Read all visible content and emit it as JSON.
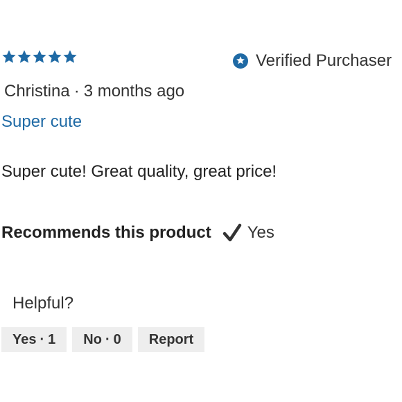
{
  "review": {
    "rating": 5,
    "rating_max": 5,
    "star_color": "#1f6aa5",
    "verified_label": "Verified Purchaser",
    "author": "Christina",
    "separator": "·",
    "time_ago": "3 months ago",
    "title": "Super cute",
    "body": "Super cute! Great quality, great price!",
    "recommends_label": "Recommends this product",
    "recommends_value": "Yes",
    "recommends_icon": "checkmark-icon",
    "verified_icon": "star-badge-icon"
  },
  "helpful": {
    "label": "Helpful?",
    "yes_label": "Yes",
    "yes_count": "1",
    "no_label": "No",
    "no_count": "0",
    "report_label": "Report"
  }
}
